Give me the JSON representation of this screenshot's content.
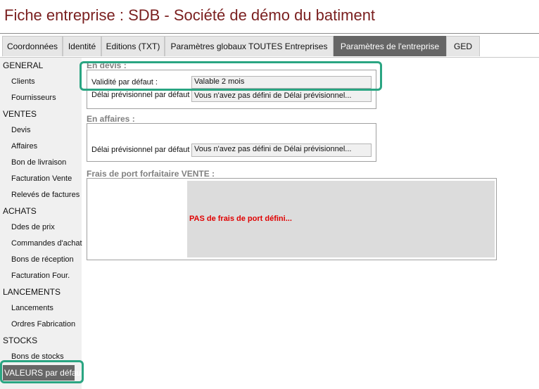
{
  "window": {
    "title": "Fiche entreprise : SDB - Société de démo du batiment"
  },
  "tabs": [
    {
      "label": "Coordonnées"
    },
    {
      "label": "Identité"
    },
    {
      "label": "Editions (TXT)"
    },
    {
      "label": "Paramètres globaux TOUTES Entreprises"
    },
    {
      "label": "Paramètres de l'entreprise"
    },
    {
      "label": "GED"
    }
  ],
  "sidebar": {
    "items": [
      {
        "label": "GENERAL"
      },
      {
        "label": "Clients"
      },
      {
        "label": "Fournisseurs"
      },
      {
        "label": "VENTES"
      },
      {
        "label": "Devis"
      },
      {
        "label": "Affaires"
      },
      {
        "label": "Bon de livraison"
      },
      {
        "label": "Facturation Vente"
      },
      {
        "label": "Relevés de factures"
      },
      {
        "label": "ACHATS"
      },
      {
        "label": "Ddes de prix"
      },
      {
        "label": "Commandes d'achat"
      },
      {
        "label": "Bons de réception"
      },
      {
        "label": "Facturation Four."
      },
      {
        "label": "LANCEMENTS"
      },
      {
        "label": "Lancements"
      },
      {
        "label": "Ordres Fabrication"
      },
      {
        "label": "STOCKS"
      },
      {
        "label": "Bons de stocks"
      },
      {
        "label": "VALEURS par défaut"
      }
    ]
  },
  "devis": {
    "title": "En devis :",
    "validite_label": "Validité par défaut :",
    "validite_value": "Valable 2 mois",
    "delai_label": "Délai prévisionnel par défaut :",
    "delai_value": "Vous n'avez pas défini de Délai prévisionnel..."
  },
  "affaires": {
    "title": "En affaires :",
    "delai_label": "Délai prévisionnel par défaut :",
    "delai_value": "Vous n'avez pas défini de Délai prévisionnel..."
  },
  "frais": {
    "title": "Frais de port forfaitaire VENTE :",
    "message": "PAS de frais de port défini..."
  },
  "colors": {
    "accent": "#2aa582",
    "title": "#7a1f1f",
    "active_tab": "#666666",
    "warning": "#e00000"
  }
}
